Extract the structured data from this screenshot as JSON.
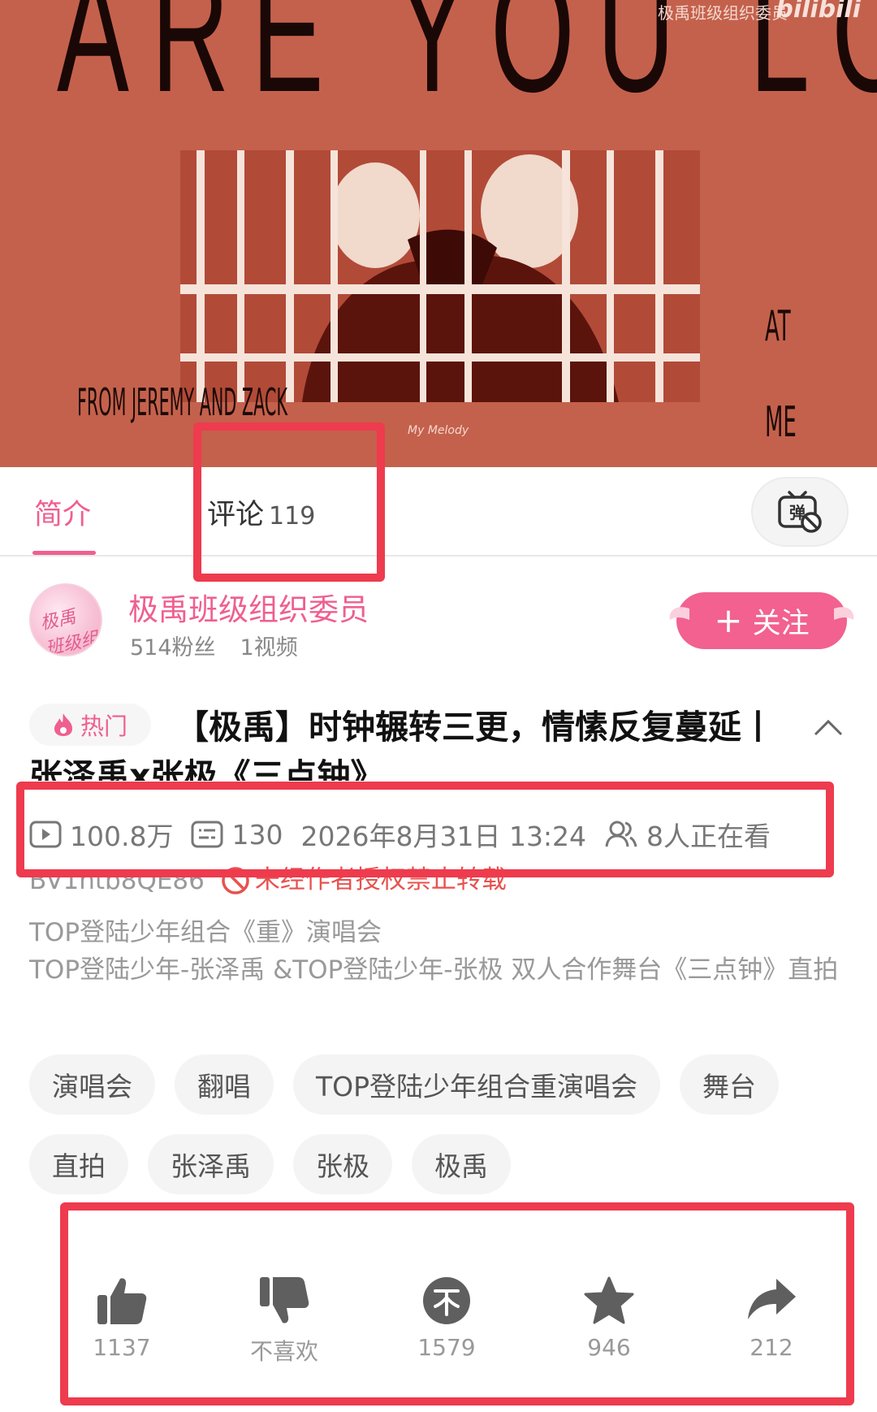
{
  "cover": {
    "title_text": "ARE YOU LOOK",
    "watermark": "极禹班级组织委员",
    "platform_logo": "bilibili",
    "from_text": "FROM JEREMY AND ZACK",
    "side_text_top": "AT",
    "side_text_bottom": "ME",
    "photo_logo": "My Melody"
  },
  "tabs": {
    "intro_label": "简介",
    "comments_label": "评论",
    "comments_count": "119",
    "danmaku_icon": "danmaku-off-icon"
  },
  "uploader": {
    "name": "极禹班级组织委员",
    "fans": "514粉丝",
    "videos": "1视频",
    "avatar_text": "极禹 班级组",
    "follow_label": "关注"
  },
  "video": {
    "hot_label": "热门",
    "title": "【极禹】时钟辗转三更，情愫反复蔓延丨张泽禹x张极《三点钟》",
    "views": "100.8万",
    "danmaku_count": "130",
    "datetime": "2026年8月31日 13:24",
    "watching": "8人正在看",
    "bv": "BV1ntb8QE86",
    "copyright_notice": "未经作者授权禁止转载",
    "description_lines": [
      "TOP登陆少年组合《重》演唱会",
      "TOP登陆少年-张泽禹 &TOP登陆少年-张极 双人合作舞台《三点钟》直拍"
    ]
  },
  "tags": [
    "演唱会",
    "翻唱",
    "TOP登陆少年组合重演唱会",
    "舞台",
    "直拍",
    "张泽禹",
    "张极",
    "极禹"
  ],
  "actions": {
    "like": "1137",
    "dislike": "不喜欢",
    "coin": "1579",
    "favorite": "946",
    "share": "212"
  },
  "colors": {
    "accent_pink": "#ef5f8f",
    "cover_red": "#c4614c",
    "highlight_red": "#ee3b4e",
    "icon_gray": "#5f5f5f"
  }
}
